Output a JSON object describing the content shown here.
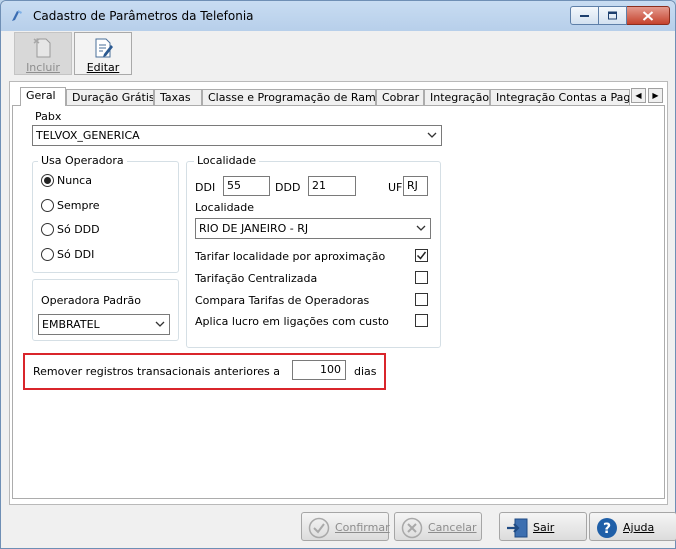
{
  "window": {
    "title": "Cadastro de Parâmetros da Telefonia"
  },
  "toolbar": {
    "incluir_label": "Incluir",
    "editar_label": "Editar"
  },
  "tabs": [
    {
      "label": "Geral"
    },
    {
      "label": "Duração Grátis"
    },
    {
      "label": "Taxas"
    },
    {
      "label": "Classe e Programação de Ramal"
    },
    {
      "label": "Cobrar"
    },
    {
      "label": "Integração"
    },
    {
      "label": "Integração Contas a Pagar"
    }
  ],
  "geral": {
    "pabx_label": "Pabx",
    "pabx_value": "TELVOX_GENERICA",
    "usa_operadora": {
      "title": "Usa Operadora",
      "options": [
        "Nunca",
        "Sempre",
        "Só DDD",
        "Só DDI"
      ],
      "selected": "Nunca"
    },
    "operadora_padrao": {
      "title": "Operadora Padrão",
      "value": "EMBRATEL"
    },
    "localidade": {
      "title": "Localidade",
      "ddi_label": "DDI",
      "ddi_value": "55",
      "ddd_label": "DDD",
      "ddd_value": "21",
      "uf_label": "UF",
      "uf_value": "RJ",
      "localidade_label": "Localidade",
      "localidade_value": "RIO DE JANEIRO - RJ",
      "checks": [
        {
          "label": "Tarifar localidade por aproximação",
          "checked": true
        },
        {
          "label": "Tarifação Centralizada",
          "checked": false
        },
        {
          "label": "Compara Tarifas de Operadoras",
          "checked": false
        },
        {
          "label": "Aplica lucro em ligações com custo",
          "checked": false
        }
      ]
    },
    "remover": {
      "label": "Remover registros transacionais anteriores a",
      "value": "100",
      "unit": "dias"
    }
  },
  "buttons": {
    "confirmar": "Confirmar",
    "cancelar": "Cancelar",
    "sair": "Sair",
    "ajuda": "Ajuda"
  },
  "colors": {
    "highlight": "#d9252b",
    "help_blue": "#1f5fa8"
  },
  "icons": {
    "app": "phone-app-icon",
    "incluir": "new-document-icon",
    "editar": "edit-document-icon",
    "confirmar": "check-circle-icon",
    "cancelar": "cancel-circle-icon",
    "sair": "exit-door-icon",
    "ajuda": "help-icon"
  }
}
